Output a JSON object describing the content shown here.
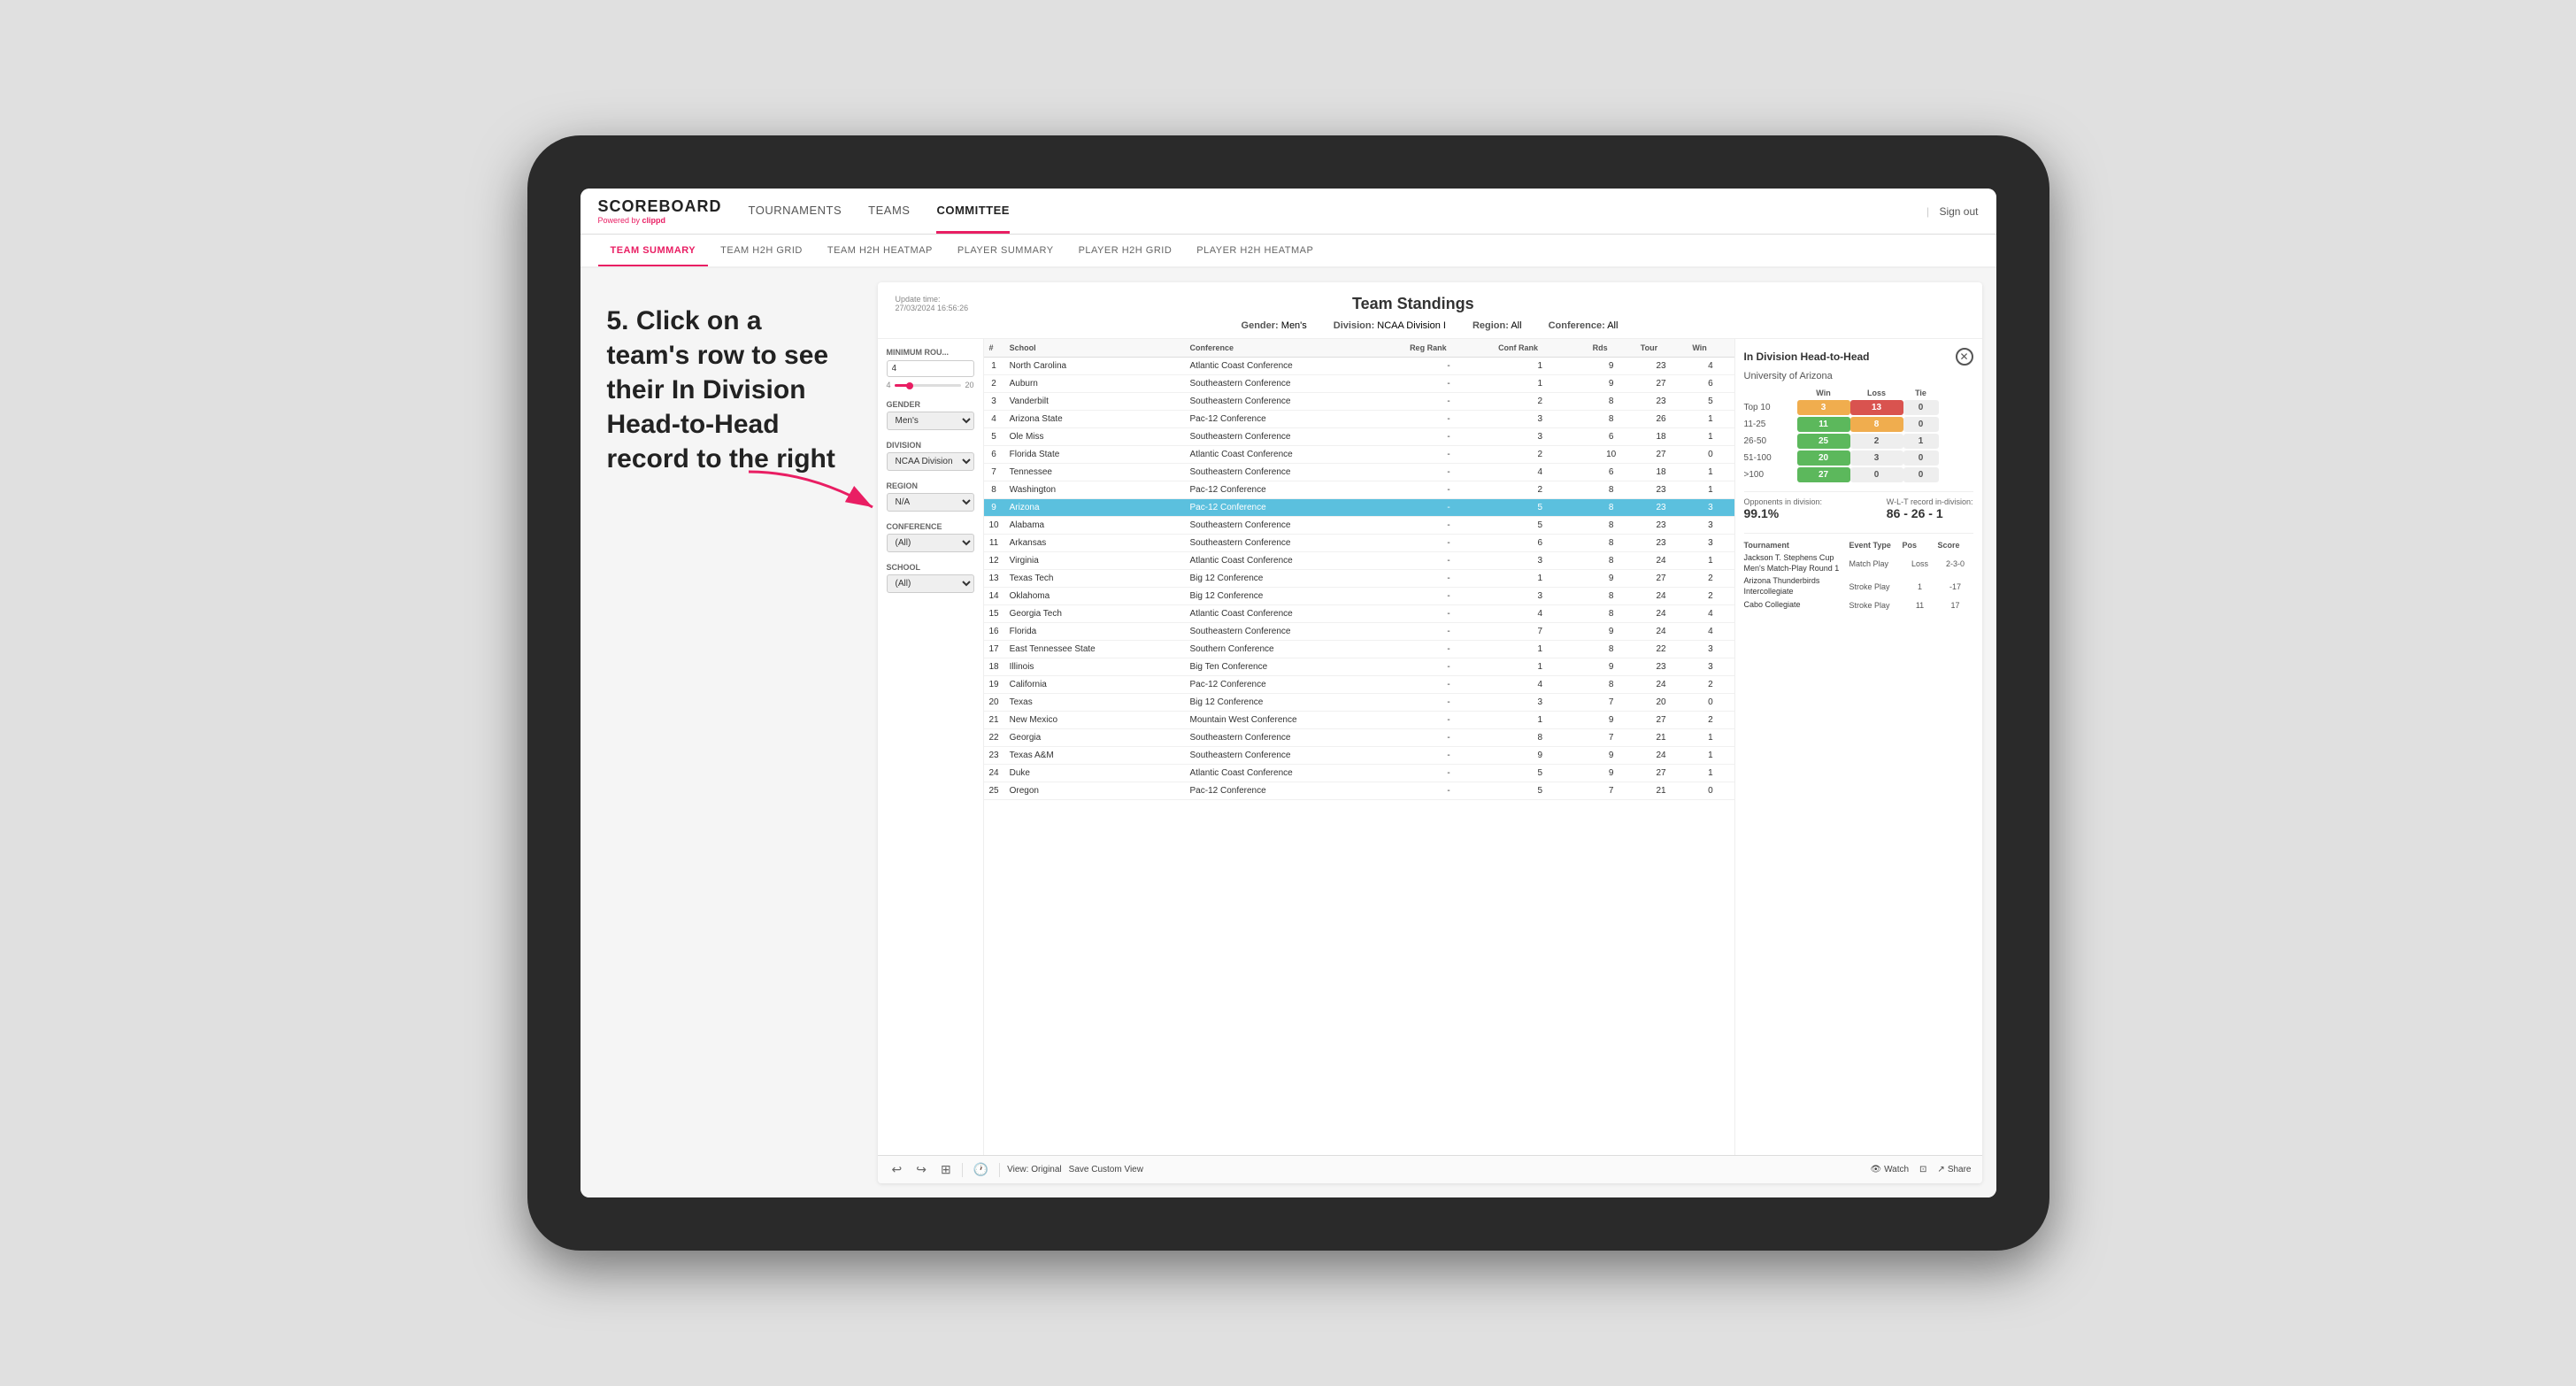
{
  "app": {
    "logo": "SCOREBOARD",
    "logo_sub": "Powered by",
    "logo_brand": "clippd",
    "nav_items": [
      "TOURNAMENTS",
      "TEAMS",
      "COMMITTEE"
    ],
    "active_nav": "COMMITTEE",
    "sign_out": "Sign out",
    "sub_nav": [
      "TEAM SUMMARY",
      "TEAM H2H GRID",
      "TEAM H2H HEATMAP",
      "PLAYER SUMMARY",
      "PLAYER H2H GRID",
      "PLAYER H2H HEATMAP"
    ],
    "active_sub": "PLAYER SUMMARY"
  },
  "annotation": {
    "text": "5. Click on a team's row to see their In Division Head-to-Head record to the right"
  },
  "panel": {
    "title": "Team Standings",
    "update_label": "Update time:",
    "update_time": "27/03/2024 16:56:26",
    "filters": {
      "gender_label": "Gender:",
      "gender_value": "Men's",
      "division_label": "Division:",
      "division_value": "NCAA Division I",
      "region_label": "Region:",
      "region_value": "All",
      "conference_label": "Conference:",
      "conference_value": "All"
    }
  },
  "controls": {
    "min_rounds_label": "Minimum Rou...",
    "min_rounds_value": "4",
    "gender_label": "Gender",
    "gender_value": "Men's",
    "division_label": "Division",
    "division_value": "NCAA Division I",
    "region_label": "Region",
    "region_value": "N/A",
    "conference_label": "Conference",
    "conference_value": "(All)",
    "school_label": "School",
    "school_value": "(All)"
  },
  "table": {
    "headers": [
      "#",
      "School",
      "Conference",
      "Reg Rank",
      "Conf Rank",
      "Rds",
      "Tour",
      "Win"
    ],
    "rows": [
      {
        "rank": "1",
        "school": "North Carolina",
        "conference": "Atlantic Coast Conference",
        "reg_rank": "-",
        "conf_rank": "1",
        "rds": "9",
        "tour": "23",
        "win": "4",
        "highlighted": false
      },
      {
        "rank": "2",
        "school": "Auburn",
        "conference": "Southeastern Conference",
        "reg_rank": "-",
        "conf_rank": "1",
        "rds": "9",
        "tour": "27",
        "win": "6",
        "highlighted": false
      },
      {
        "rank": "3",
        "school": "Vanderbilt",
        "conference": "Southeastern Conference",
        "reg_rank": "-",
        "conf_rank": "2",
        "rds": "8",
        "tour": "23",
        "win": "5",
        "highlighted": false
      },
      {
        "rank": "4",
        "school": "Arizona State",
        "conference": "Pac-12 Conference",
        "reg_rank": "-",
        "conf_rank": "3",
        "rds": "8",
        "tour": "26",
        "win": "1",
        "highlighted": false
      },
      {
        "rank": "5",
        "school": "Ole Miss",
        "conference": "Southeastern Conference",
        "reg_rank": "-",
        "conf_rank": "3",
        "rds": "6",
        "tour": "18",
        "win": "1",
        "highlighted": false
      },
      {
        "rank": "6",
        "school": "Florida State",
        "conference": "Atlantic Coast Conference",
        "reg_rank": "-",
        "conf_rank": "2",
        "rds": "10",
        "tour": "27",
        "win": "0",
        "highlighted": false
      },
      {
        "rank": "7",
        "school": "Tennessee",
        "conference": "Southeastern Conference",
        "reg_rank": "-",
        "conf_rank": "4",
        "rds": "6",
        "tour": "18",
        "win": "1",
        "highlighted": false
      },
      {
        "rank": "8",
        "school": "Washington",
        "conference": "Pac-12 Conference",
        "reg_rank": "-",
        "conf_rank": "2",
        "rds": "8",
        "tour": "23",
        "win": "1",
        "highlighted": false
      },
      {
        "rank": "9",
        "school": "Arizona",
        "conference": "Pac-12 Conference",
        "reg_rank": "-",
        "conf_rank": "5",
        "rds": "8",
        "tour": "23",
        "win": "3",
        "highlighted": true
      },
      {
        "rank": "10",
        "school": "Alabama",
        "conference": "Southeastern Conference",
        "reg_rank": "-",
        "conf_rank": "5",
        "rds": "8",
        "tour": "23",
        "win": "3",
        "highlighted": false
      },
      {
        "rank": "11",
        "school": "Arkansas",
        "conference": "Southeastern Conference",
        "reg_rank": "-",
        "conf_rank": "6",
        "rds": "8",
        "tour": "23",
        "win": "3",
        "highlighted": false
      },
      {
        "rank": "12",
        "school": "Virginia",
        "conference": "Atlantic Coast Conference",
        "reg_rank": "-",
        "conf_rank": "3",
        "rds": "8",
        "tour": "24",
        "win": "1",
        "highlighted": false
      },
      {
        "rank": "13",
        "school": "Texas Tech",
        "conference": "Big 12 Conference",
        "reg_rank": "-",
        "conf_rank": "1",
        "rds": "9",
        "tour": "27",
        "win": "2",
        "highlighted": false
      },
      {
        "rank": "14",
        "school": "Oklahoma",
        "conference": "Big 12 Conference",
        "reg_rank": "-",
        "conf_rank": "3",
        "rds": "8",
        "tour": "24",
        "win": "2",
        "highlighted": false
      },
      {
        "rank": "15",
        "school": "Georgia Tech",
        "conference": "Atlantic Coast Conference",
        "reg_rank": "-",
        "conf_rank": "4",
        "rds": "8",
        "tour": "24",
        "win": "4",
        "highlighted": false
      },
      {
        "rank": "16",
        "school": "Florida",
        "conference": "Southeastern Conference",
        "reg_rank": "-",
        "conf_rank": "7",
        "rds": "9",
        "tour": "24",
        "win": "4",
        "highlighted": false
      },
      {
        "rank": "17",
        "school": "East Tennessee State",
        "conference": "Southern Conference",
        "reg_rank": "-",
        "conf_rank": "1",
        "rds": "8",
        "tour": "22",
        "win": "3",
        "highlighted": false
      },
      {
        "rank": "18",
        "school": "Illinois",
        "conference": "Big Ten Conference",
        "reg_rank": "-",
        "conf_rank": "1",
        "rds": "9",
        "tour": "23",
        "win": "3",
        "highlighted": false
      },
      {
        "rank": "19",
        "school": "California",
        "conference": "Pac-12 Conference",
        "reg_rank": "-",
        "conf_rank": "4",
        "rds": "8",
        "tour": "24",
        "win": "2",
        "highlighted": false
      },
      {
        "rank": "20",
        "school": "Texas",
        "conference": "Big 12 Conference",
        "reg_rank": "-",
        "conf_rank": "3",
        "rds": "7",
        "tour": "20",
        "win": "0",
        "highlighted": false
      },
      {
        "rank": "21",
        "school": "New Mexico",
        "conference": "Mountain West Conference",
        "reg_rank": "-",
        "conf_rank": "1",
        "rds": "9",
        "tour": "27",
        "win": "2",
        "highlighted": false
      },
      {
        "rank": "22",
        "school": "Georgia",
        "conference": "Southeastern Conference",
        "reg_rank": "-",
        "conf_rank": "8",
        "rds": "7",
        "tour": "21",
        "win": "1",
        "highlighted": false
      },
      {
        "rank": "23",
        "school": "Texas A&M",
        "conference": "Southeastern Conference",
        "reg_rank": "-",
        "conf_rank": "9",
        "rds": "9",
        "tour": "24",
        "win": "1",
        "highlighted": false
      },
      {
        "rank": "24",
        "school": "Duke",
        "conference": "Atlantic Coast Conference",
        "reg_rank": "-",
        "conf_rank": "5",
        "rds": "9",
        "tour": "27",
        "win": "1",
        "highlighted": false
      },
      {
        "rank": "25",
        "school": "Oregon",
        "conference": "Pac-12 Conference",
        "reg_rank": "-",
        "conf_rank": "5",
        "rds": "7",
        "tour": "21",
        "win": "0",
        "highlighted": false
      }
    ]
  },
  "h2h": {
    "title": "In Division Head-to-Head",
    "school": "University of Arizona",
    "col_headers": [
      "",
      "Win",
      "Loss",
      "Tie"
    ],
    "rows": [
      {
        "label": "Top 10",
        "win": "3",
        "loss": "13",
        "tie": "0",
        "win_color": "yellow",
        "loss_color": "red",
        "tie_color": "neutral"
      },
      {
        "label": "11-25",
        "win": "11",
        "loss": "8",
        "tie": "0",
        "win_color": "green",
        "loss_color": "yellow",
        "tie_color": "neutral"
      },
      {
        "label": "26-50",
        "win": "25",
        "loss": "2",
        "tie": "1",
        "win_color": "green",
        "loss_color": "neutral",
        "tie_color": "neutral"
      },
      {
        "label": "51-100",
        "win": "20",
        "loss": "3",
        "tie": "0",
        "win_color": "green",
        "loss_color": "neutral",
        "tie_color": "neutral"
      },
      {
        "label": ">100",
        "win": "27",
        "loss": "0",
        "tie": "0",
        "win_color": "green",
        "loss_color": "neutral",
        "tie_color": "neutral"
      }
    ],
    "opponents_label": "Opponents in division:",
    "opponents_value": "99.1%",
    "record_label": "W-L-T record in-division:",
    "record_value": "86 - 26 - 1",
    "tournament_headers": [
      "Tournament",
      "Event Type",
      "Pos",
      "Score"
    ],
    "tournaments": [
      {
        "name": "Jackson T. Stephens Cup Men's Match-Play Round 1",
        "type": "Match Play",
        "pos": "Loss",
        "score": "2-3-0"
      },
      {
        "name": "Arizona Thunderbirds Intercollegiate",
        "type": "Stroke Play",
        "pos": "1",
        "score": "-17"
      },
      {
        "name": "Cabo Collegiate",
        "type": "Stroke Play",
        "pos": "11",
        "score": "17"
      }
    ]
  },
  "toolbar": {
    "undo_icon": "↩",
    "redo_icon": "↪",
    "copy_icon": "⊞",
    "view_original": "View: Original",
    "save_custom": "Save Custom View",
    "watch": "Watch",
    "share": "Share"
  }
}
